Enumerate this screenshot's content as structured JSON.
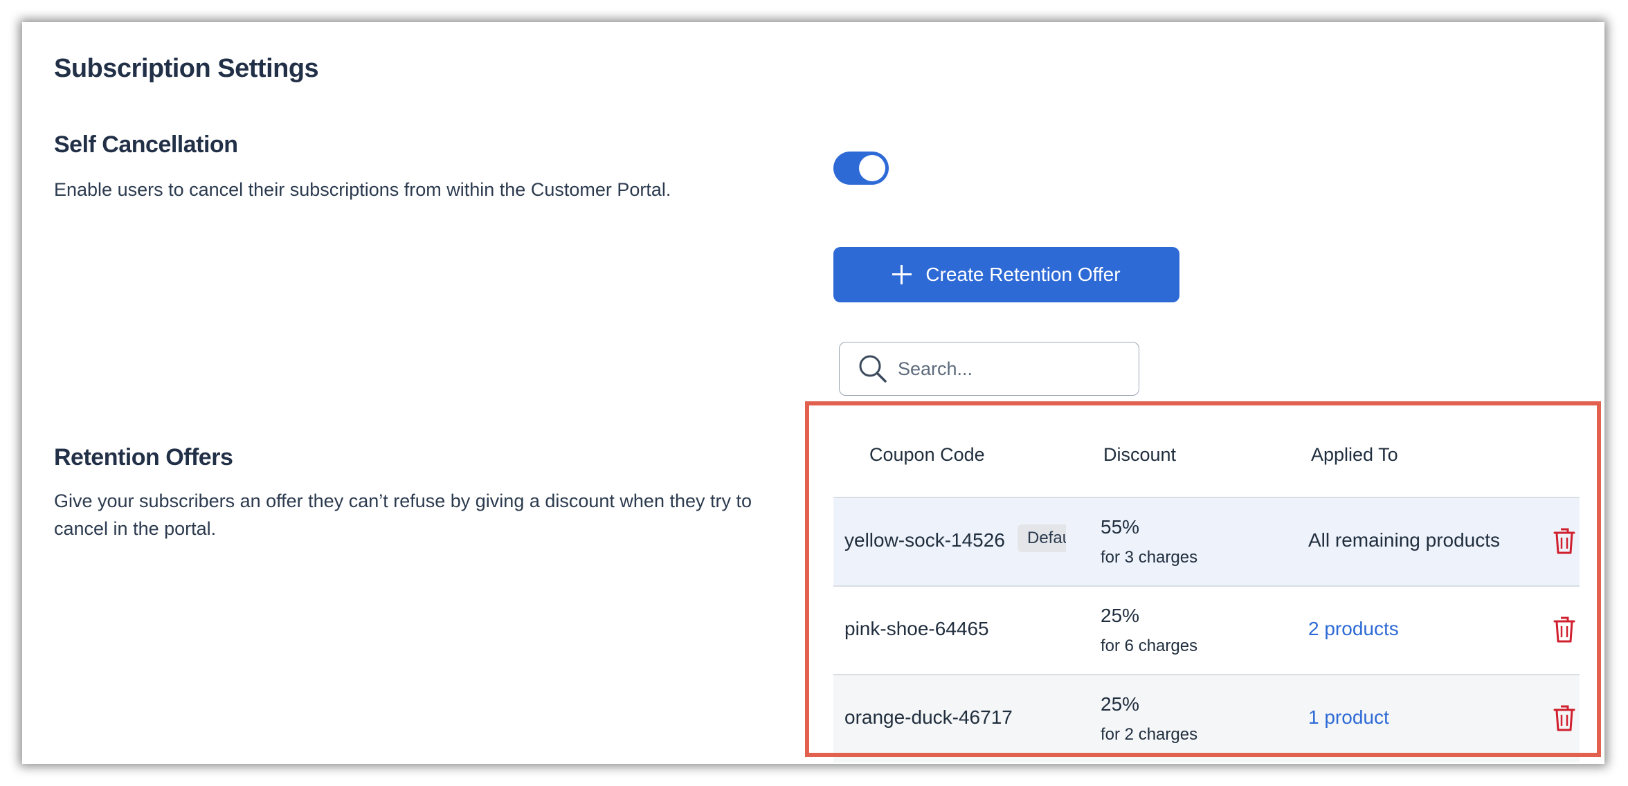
{
  "page": {
    "title": "Subscription Settings"
  },
  "self_cancellation": {
    "title": "Self Cancellation",
    "description": "Enable users to cancel their subscriptions from within the Customer Portal.",
    "enabled": true
  },
  "retention_offers": {
    "title": "Retention Offers",
    "description_line1": "Give your subscribers an offer they can’t refuse by giving a discount when they try to",
    "description_line2": "cancel in the portal.",
    "create_button_label": "Create Retention Offer",
    "search_placeholder": "Search...",
    "columns": {
      "coupon_code": "Coupon Code",
      "discount": "Discount",
      "applied_to": "Applied To"
    },
    "rows": [
      {
        "coupon_code": "yellow-sock-14526",
        "badge": "Default",
        "discount": "55%",
        "discount_detail": "for 3 charges",
        "applied_to": "All remaining products",
        "applied_is_link": false
      },
      {
        "coupon_code": "pink-shoe-64465",
        "discount": "25%",
        "discount_detail": "for 6 charges",
        "applied_to": "2 products",
        "applied_is_link": true
      },
      {
        "coupon_code": "orange-duck-46717",
        "discount": "25%",
        "discount_detail": "for 2 charges",
        "applied_to": "1 product",
        "applied_is_link": true
      }
    ]
  },
  "colors": {
    "accent": "#2e6ad6",
    "highlight_frame": "#e2614e",
    "delete_icon": "#d0202f"
  },
  "icons": {
    "search": "search-icon",
    "plus": "plus-icon",
    "delete": "trash-icon"
  }
}
